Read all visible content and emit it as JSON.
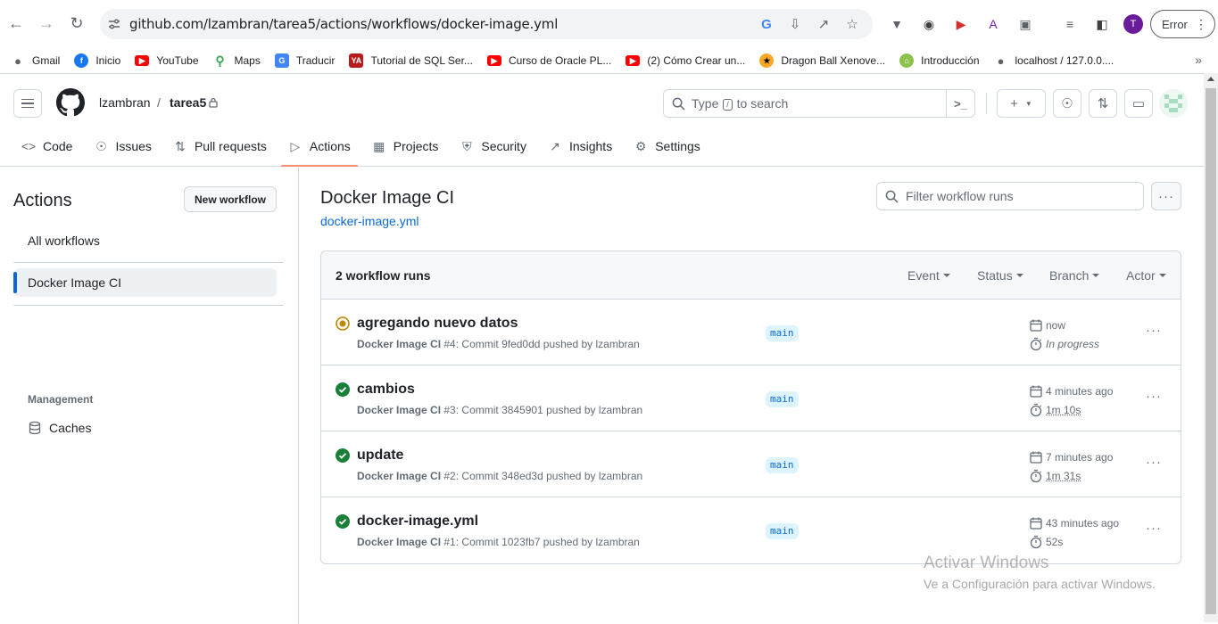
{
  "browser": {
    "url": "github.com/lzambran/tarea5/actions/workflows/docker-image.yml",
    "profile_initial": "T",
    "error_label": "Error",
    "bookmarks": [
      {
        "label": "Gmail"
      },
      {
        "label": "Inicio"
      },
      {
        "label": "YouTube"
      },
      {
        "label": "Maps"
      },
      {
        "label": "Traducir"
      },
      {
        "label": "Tutorial de SQL Ser..."
      },
      {
        "label": "Curso de Oracle PL..."
      },
      {
        "label": "(2) Cómo Crear un..."
      },
      {
        "label": "Dragon Ball Xenove..."
      },
      {
        "label": "Introducción"
      },
      {
        "label": "localhost / 127.0.0...."
      }
    ]
  },
  "header": {
    "owner": "lzambran",
    "separator": "/",
    "repo": "tarea5",
    "search_pre": "Type",
    "search_key": "/",
    "search_post": "to search"
  },
  "tabs": [
    {
      "label": "Code"
    },
    {
      "label": "Issues"
    },
    {
      "label": "Pull requests"
    },
    {
      "label": "Actions"
    },
    {
      "label": "Projects"
    },
    {
      "label": "Security"
    },
    {
      "label": "Insights"
    },
    {
      "label": "Settings"
    }
  ],
  "sidebar": {
    "title": "Actions",
    "new_workflow": "New workflow",
    "all_workflows": "All workflows",
    "active_workflow": "Docker Image CI",
    "management_heading": "Management",
    "caches": "Caches"
  },
  "main": {
    "title": "Docker Image CI",
    "file_link": "docker-image.yml",
    "filter_placeholder": "Filter workflow runs",
    "runs_count": "2 workflow runs",
    "filters": [
      "Event",
      "Status",
      "Branch",
      "Actor"
    ],
    "runs": [
      {
        "title": "agregando nuevo datos",
        "workflow": "Docker Image CI",
        "meta": " #4: Commit 9fed0dd pushed by lzambran",
        "branch": "main",
        "when": "now",
        "duration": "In progress",
        "status": "in_progress"
      },
      {
        "title": "cambios",
        "workflow": "Docker Image CI",
        "meta": " #3: Commit 3845901 pushed by lzambran",
        "branch": "main",
        "when": "4 minutes ago",
        "duration": "1m 10s",
        "status": "success"
      },
      {
        "title": "update",
        "workflow": "Docker Image CI",
        "meta": " #2: Commit 348ed3d pushed by lzambran",
        "branch": "main",
        "when": "7 minutes ago",
        "duration": "1m 31s",
        "status": "success"
      },
      {
        "title": "docker-image.yml",
        "workflow": "Docker Image CI",
        "meta": " #1: Commit 1023fb7 pushed by lzambran",
        "branch": "main",
        "when": "43 minutes ago",
        "duration": "52s",
        "status": "success"
      }
    ]
  },
  "watermark": {
    "line1": "Activar Windows",
    "line2": "Ve a Configuración para activar Windows."
  },
  "colors": {
    "accent_link": "#0969da",
    "success": "#1a7f37",
    "in_progress": "#bf8700",
    "tab_underline": "#fd8c73"
  }
}
